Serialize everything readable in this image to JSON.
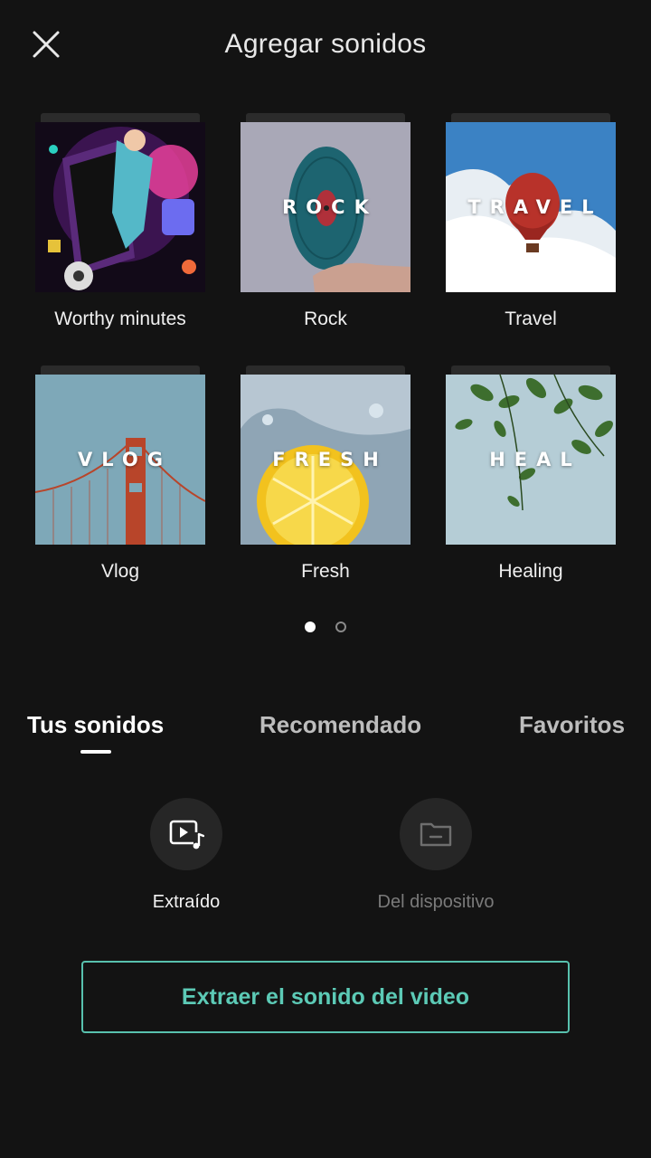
{
  "header": {
    "title": "Agregar sonidos",
    "close_icon": "close-icon"
  },
  "categories": [
    {
      "label": "Worthy minutes",
      "cover_text": ""
    },
    {
      "label": "Rock",
      "cover_text": "ROCK"
    },
    {
      "label": "Travel",
      "cover_text": "TRAVEL"
    },
    {
      "label": "Vlog",
      "cover_text": "VLOG"
    },
    {
      "label": "Fresh",
      "cover_text": "FRESH"
    },
    {
      "label": "Healing",
      "cover_text": "HEAL"
    }
  ],
  "pagination": {
    "current": 1,
    "total": 2
  },
  "tabs": [
    {
      "label": "Tus sonidos",
      "active": true
    },
    {
      "label": "Recomendado",
      "active": false
    },
    {
      "label": "Favoritos",
      "active": false
    }
  ],
  "sources": [
    {
      "label": "Extraído",
      "icon": "video-music-icon",
      "enabled": true
    },
    {
      "label": "Del dispositivo",
      "icon": "folder-icon",
      "enabled": false
    }
  ],
  "extract_button": {
    "label": "Extraer el sonido del video"
  },
  "colors": {
    "background": "#131313",
    "accent": "#5ccab6",
    "text_primary": "#ffffff",
    "text_disabled": "#7a7a7a"
  }
}
